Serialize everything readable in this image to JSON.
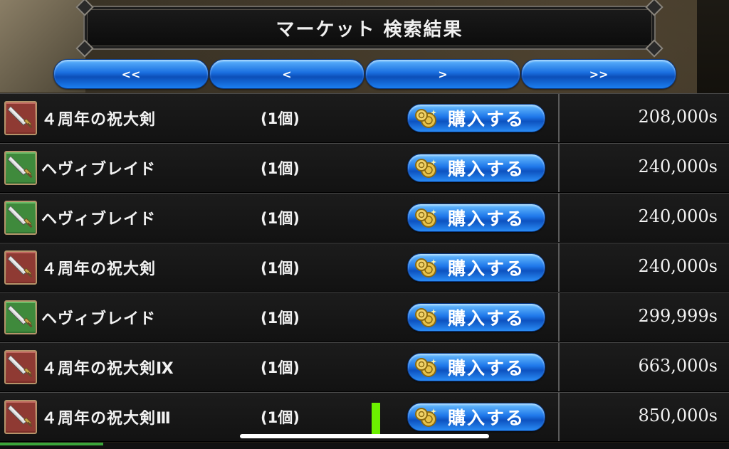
{
  "header": {
    "title": "マーケット 検索結果"
  },
  "nav": {
    "first_label": "<<",
    "prev_label": "<",
    "next_label": ">",
    "last_label": ">>"
  },
  "buy_label": "購入する",
  "rows": [
    {
      "name": "４周年の祝大剣",
      "qty": "(1個)",
      "price": "208,000s",
      "icon": "red-sword-icon"
    },
    {
      "name": "ヘヴィブレイド",
      "qty": "(1個)",
      "price": "240,000s",
      "icon": "green-sword-icon"
    },
    {
      "name": "ヘヴィブレイド",
      "qty": "(1個)",
      "price": "240,000s",
      "icon": "green-sword-icon"
    },
    {
      "name": "４周年の祝大剣",
      "qty": "(1個)",
      "price": "240,000s",
      "icon": "red-sword-icon"
    },
    {
      "name": "ヘヴィブレイド",
      "qty": "(1個)",
      "price": "299,999s",
      "icon": "green-sword-icon"
    },
    {
      "name": "４周年の祝大剣Ⅸ",
      "qty": "(1個)",
      "price": "663,000s",
      "icon": "red-sword-icon"
    },
    {
      "name": "４周年の祝大剣Ⅲ",
      "qty": "(1個)",
      "price": "850,000s",
      "icon": "red-sword-icon"
    }
  ],
  "colors": {
    "button_blue": "#1a6fe0",
    "row_bg": "#161616",
    "text": "#f2f2f2",
    "icon_red": "#a84a42",
    "icon_green": "#4c9a48"
  }
}
